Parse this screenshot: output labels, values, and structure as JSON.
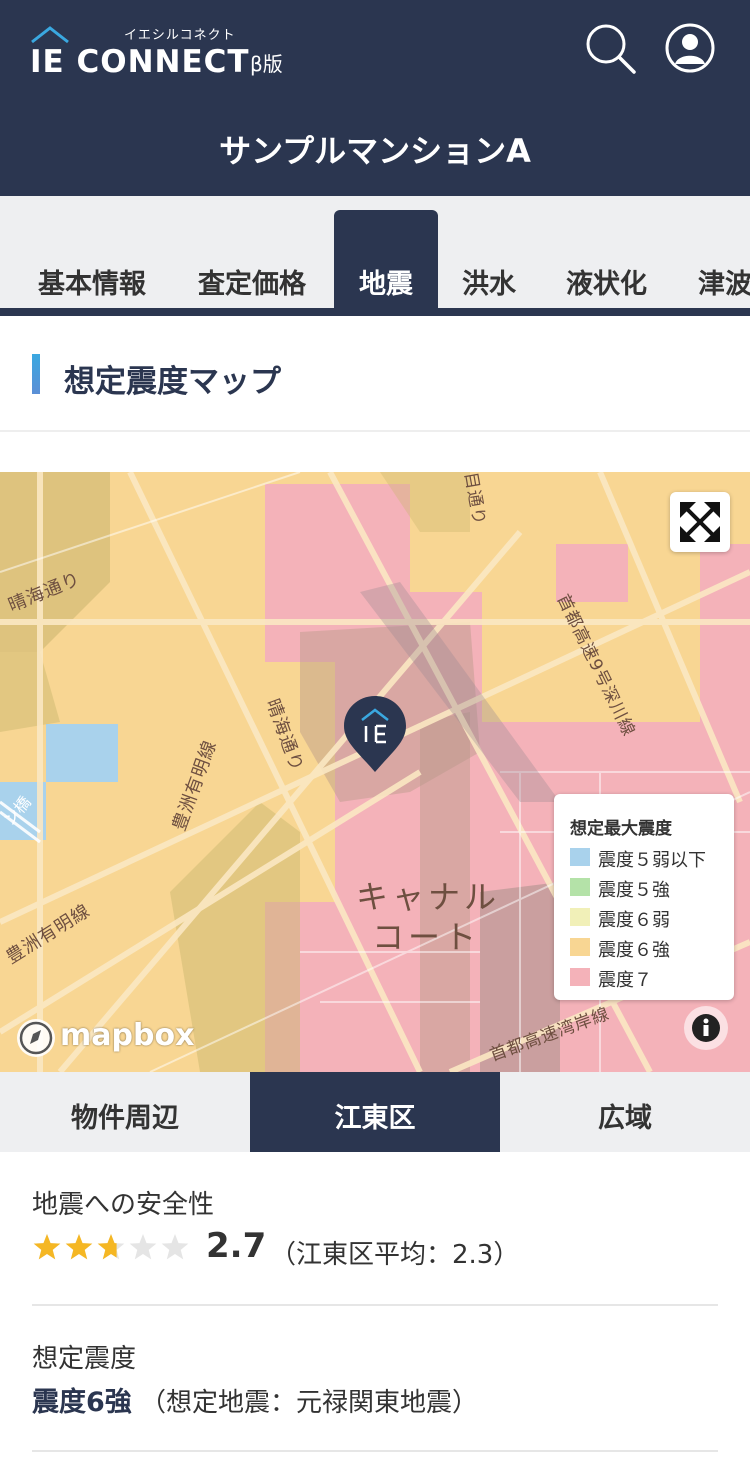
{
  "header": {
    "logo_kana": "イエシルコネクト",
    "logo_main": "IE CONNECT",
    "logo_beta": "β版",
    "title": "サンプルマンションA",
    "icons": [
      "search-icon",
      "user-icon"
    ]
  },
  "tabs": [
    {
      "label": "基本情報",
      "active": false
    },
    {
      "label": "査定価格",
      "active": false
    },
    {
      "label": "地震",
      "active": true
    },
    {
      "label": "洪水",
      "active": false
    },
    {
      "label": "液状化",
      "active": false
    },
    {
      "label": "津波",
      "active": false
    }
  ],
  "section": {
    "title": "想定震度マップ"
  },
  "map": {
    "labels": {
      "harumi1": "晴海通り",
      "harumi2": "晴海通り",
      "toyosu1": "豊洲有明線",
      "toyosu2": "豊洲有明線",
      "shuto1": "首都高速9号深川線",
      "shuto2": "首都高速湾岸線",
      "me": "目通り",
      "hashi": "ン橋"
    },
    "area_label_1": "キャナル",
    "area_label_2": "コート",
    "legend": {
      "title": "想定最大震度",
      "items": [
        {
          "label": "震度５弱以下",
          "color": "#a9d2ec"
        },
        {
          "label": "震度５強",
          "color": "#b4e2a8"
        },
        {
          "label": "震度６弱",
          "color": "#f1f0b8"
        },
        {
          "label": "震度６強",
          "color": "#f8d693"
        },
        {
          "label": "震度７",
          "color": "#f4b2b9"
        }
      ]
    },
    "attribution": "mapbox"
  },
  "segments": [
    {
      "label": "物件周辺",
      "active": false
    },
    {
      "label": "江東区",
      "active": true
    },
    {
      "label": "広域",
      "active": false
    }
  ],
  "safety": {
    "label": "地震への安全性",
    "rating": 2.7,
    "score": "2.7",
    "average": "（江東区平均：2.3）"
  },
  "intensity": {
    "label": "想定震度",
    "value": "震度6強",
    "note": "（想定地震：元禄関東地震）"
  }
}
